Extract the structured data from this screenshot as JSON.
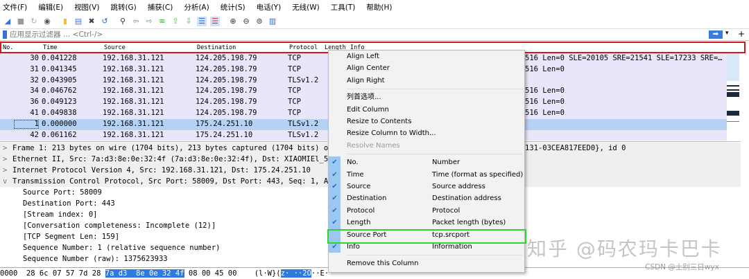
{
  "menu": [
    "文件(F)",
    "编辑(E)",
    "视图(V)",
    "跳转(G)",
    "捕获(C)",
    "分析(A)",
    "统计(S)",
    "电话(Y)",
    "无线(W)",
    "工具(T)",
    "帮助(H)"
  ],
  "toolbar": [
    "shark-fin-start-icon",
    "stop-icon",
    "restart-icon",
    "options-icon",
    "open-icon",
    "save-icon",
    "close-file-icon",
    "reload-icon",
    "find-icon",
    "back-icon",
    "forward-icon",
    "goto-icon",
    "first-icon",
    "last-icon",
    "autoscroll-icon",
    "colorize-icon",
    "zoom-in-icon",
    "zoom-out-icon",
    "zoom-normal-icon",
    "resize-columns-icon"
  ],
  "filter": {
    "placeholder": "应用显示过滤器 … <Ctrl-/>"
  },
  "columns": [
    "No.",
    "Time",
    "Source",
    "Destination",
    "Protocol",
    "Length",
    "Info"
  ],
  "packets": [
    {
      "no": "30",
      "time": "0.041228",
      "src": "192.168.31.121",
      "dst": "124.205.198.79",
      "proto": "TCP",
      "info": "516 Len=0 SLE=20105 SRE=21541 SLE=17233 SRE=…"
    },
    {
      "no": "31",
      "time": "0.041345",
      "src": "192.168.31.121",
      "dst": "124.205.198.79",
      "proto": "TCP",
      "info": "516 Len=0"
    },
    {
      "no": "32",
      "time": "0.043905",
      "src": "192.168.31.121",
      "dst": "124.205.198.79",
      "proto": "TLSv1.2",
      "info": ""
    },
    {
      "no": "34",
      "time": "0.046762",
      "src": "192.168.31.121",
      "dst": "124.205.198.79",
      "proto": "TCP",
      "info": "516 Len=0"
    },
    {
      "no": "36",
      "time": "0.049123",
      "src": "192.168.31.121",
      "dst": "124.205.198.79",
      "proto": "TCP",
      "info": "516 Len=0"
    },
    {
      "no": "41",
      "time": "0.049838",
      "src": "192.168.31.121",
      "dst": "124.205.198.79",
      "proto": "TCP",
      "info": "516 Len=0"
    },
    {
      "no": "1",
      "time": "0.000000",
      "src": "192.168.31.121",
      "dst": "175.24.251.10",
      "proto": "TLSv1.2",
      "info": "",
      "selected": true
    },
    {
      "no": "42",
      "time": "0.061162",
      "src": "192.168.31.121",
      "dst": "175.24.251.10",
      "proto": "TLSv1.2",
      "info": ""
    }
  ],
  "details": [
    {
      "arrow": ">",
      "text": "Frame 1: 213 bytes on wire (1704 bits), 213 bytes captured (1704 bits) o",
      "tail": "131-03CEA817EED0}, id 0",
      "indent": 0
    },
    {
      "arrow": ">",
      "text": "Ethernet II, Src: 7a:d3:8e:0e:32:4f (7a:d3:8e:0e:32:4f), Dst: XIAOMIEl_5",
      "tail": "",
      "indent": 0
    },
    {
      "arrow": ">",
      "text": "Internet Protocol Version 4, Src: 192.168.31.121, Dst: 175.24.251.10",
      "tail": "",
      "indent": 0
    },
    {
      "arrow": "v",
      "text": "Transmission Control Protocol, Src Port: 58009, Dst Port: 443, Seq: 1, A",
      "tail": "",
      "indent": 0
    },
    {
      "arrow": "",
      "text": "Source Port: 58009",
      "tail": "",
      "indent": 1
    },
    {
      "arrow": "",
      "text": "Destination Port: 443",
      "tail": "",
      "indent": 1
    },
    {
      "arrow": "",
      "text": "[Stream index: 0]",
      "tail": "",
      "indent": 1
    },
    {
      "arrow": "",
      "text": "[Conversation completeness: Incomplete (12)]",
      "tail": "",
      "indent": 1
    },
    {
      "arrow": "",
      "text": "[TCP Segment Len: 159]",
      "tail": "",
      "indent": 1
    },
    {
      "arrow": "",
      "text": "Sequence Number: 1    (relative sequence number)",
      "tail": "",
      "indent": 1
    },
    {
      "arrow": "",
      "text": "Sequence Number (raw): 1375623933",
      "tail": "",
      "indent": 1
    }
  ],
  "hex": {
    "offset": "0000",
    "pre": "28 6c 07 57 7d 28 ",
    "sel": "7a d3  8e 0e 32 4f",
    "post": " 08 00 45 00",
    "ascii_pre": "(l·W}(",
    "ascii_sel": "z· ··2O",
    "ascii_post": "··E·"
  },
  "context_menu": {
    "top": [
      "Align Left",
      "Align Center",
      "Align Right"
    ],
    "mid": [
      "列首选项...",
      "Edit Column",
      "Resize to Contents",
      "Resize Column to Width...",
      "Resolve Names"
    ],
    "columns": [
      {
        "label": "No.",
        "desc": "Number",
        "checked": true
      },
      {
        "label": "Time",
        "desc": "Time (format as specified)",
        "checked": true
      },
      {
        "label": "Source",
        "desc": "Source address",
        "checked": true
      },
      {
        "label": "Destination",
        "desc": "Destination address",
        "checked": true
      },
      {
        "label": "Protocol",
        "desc": "Protocol",
        "checked": true
      },
      {
        "label": "Length",
        "desc": "Packet length (bytes)",
        "checked": true
      },
      {
        "label": "Source Port",
        "desc": "tcp.srcport",
        "checked": false
      },
      {
        "label": "Info",
        "desc": "Information",
        "checked": true
      }
    ],
    "remove": "Remove this Column"
  },
  "colors": {
    "highlight_red": "#d8141c",
    "highlight_green": "#2fd62f",
    "row_bg": "#e8e6fb",
    "selected_row": "#b5d2f5"
  },
  "watermark": "知乎 @码农玛卡巴卡",
  "watermark2": "CSDN @士别三日wyx"
}
